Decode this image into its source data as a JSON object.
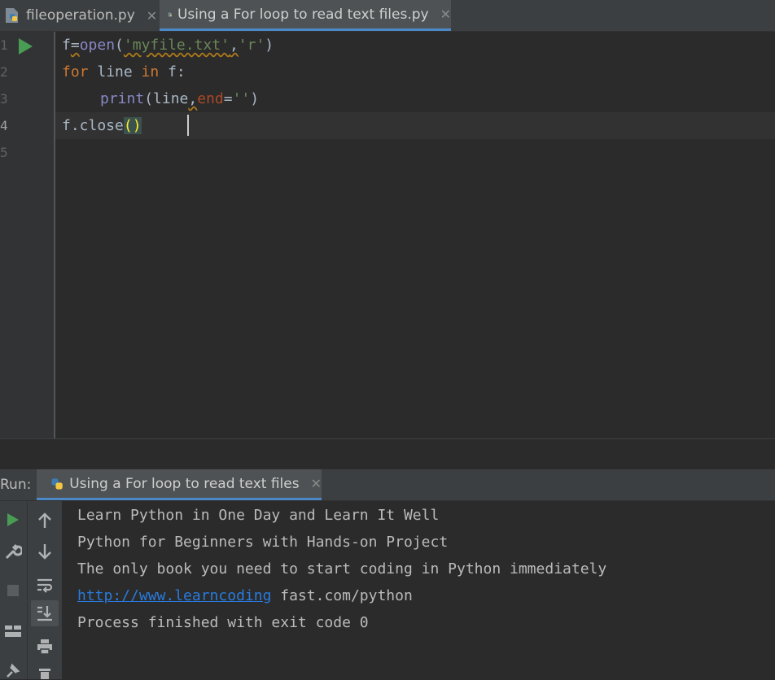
{
  "tabs": [
    {
      "label": "fileoperation.py",
      "active": false
    },
    {
      "label": "Using a For loop to read text files.py",
      "active": true
    }
  ],
  "editor": {
    "line_numbers": [
      "1",
      "2",
      "3",
      "4",
      "5"
    ],
    "code": {
      "l1": {
        "a": "f",
        "b": "=",
        "c": "open",
        "d": "(",
        "e": "'myfile.txt'",
        "f": ",",
        "g": "'r'",
        "h": ")"
      },
      "l2": {
        "a": "for",
        "b": " line ",
        "c": "in",
        "d": " f:"
      },
      "l3": {
        "a": "print",
        "b": "(line",
        "c": ",",
        "d": "end",
        "e": "=",
        "f": "''",
        "g": ")"
      },
      "l4": {
        "a": "f.close",
        "b": "(",
        "c": ")"
      }
    }
  },
  "run_panel": {
    "label": "Run:",
    "tab_label": "Using a For loop to read text files",
    "output": {
      "line1": "Learn Python in One Day and Learn It Well",
      "line2": "Python for Beginners with Hands-on Project",
      "line3": "The only book you need to start coding in Python immediately",
      "line4_link": "http://www.learncoding",
      "line4_rest": " fast.com/python",
      "line5": "Process finished with exit code 0"
    }
  },
  "colors": {
    "keyword": "#cc7832",
    "string": "#6a8759",
    "builtin": "#8888c6",
    "param": "#aa4926",
    "link": "#287bde",
    "run_green": "#499c54",
    "tab_underline": "#4a88c7"
  }
}
